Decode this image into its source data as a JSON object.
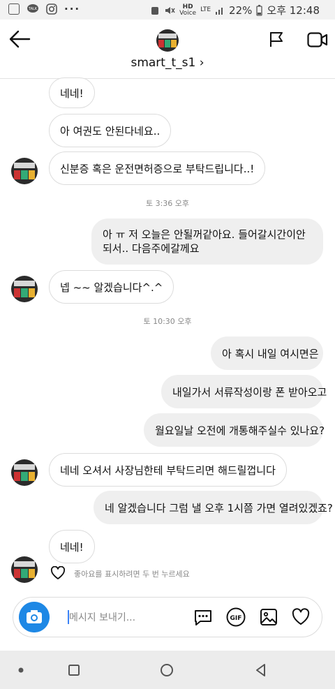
{
  "status_bar": {
    "battery": "22%",
    "clock": "오후 12:48",
    "network": "LTE",
    "hd": "HD"
  },
  "header": {
    "username": "smart_t_s1",
    "chevron": "›"
  },
  "messages": [
    {
      "type": "in",
      "text": "네네!"
    },
    {
      "type": "in",
      "text": "아 여권도 안된다네요.."
    },
    {
      "type": "in",
      "text": "신분증 혹은 운전면허증으로 부탁드립니다..!"
    },
    {
      "type": "time",
      "text": "토 3:36 오후"
    },
    {
      "type": "out",
      "text": "아 ㅠ 저 오늘은 안될꺼같아요. 들어갈시간이안되서.. 다음주에갈께요"
    },
    {
      "type": "in",
      "text": "넵 ~~ 알겠습니다^.^"
    },
    {
      "type": "time",
      "text": "토 10:30 오후"
    },
    {
      "type": "out",
      "text": "아 혹시 내일 여시면은"
    },
    {
      "type": "out",
      "text": "내일가서 서류작성이랑 폰 받아오고"
    },
    {
      "type": "out",
      "text": "월요일날 오전에 개통해주실수 있나요?"
    },
    {
      "type": "in",
      "text": "네네 오셔서 사장님한테 부탁드리면 해드릴껍니다"
    },
    {
      "type": "out",
      "text": "네 알겠습니다 그럼 낼 오후 1시쯤 가면 열려있겠죠?"
    },
    {
      "type": "in",
      "text": "네네!"
    }
  ],
  "like_hint": "좋아요를 표시하려면 두 번 누르세요",
  "composer": {
    "placeholder": "메시지 보내기...",
    "gif_label": "GIF"
  },
  "colors": {
    "accent": "#1e88e5",
    "incoming_bubble": "#ffffff",
    "outgoing_bubble": "#efefef"
  }
}
